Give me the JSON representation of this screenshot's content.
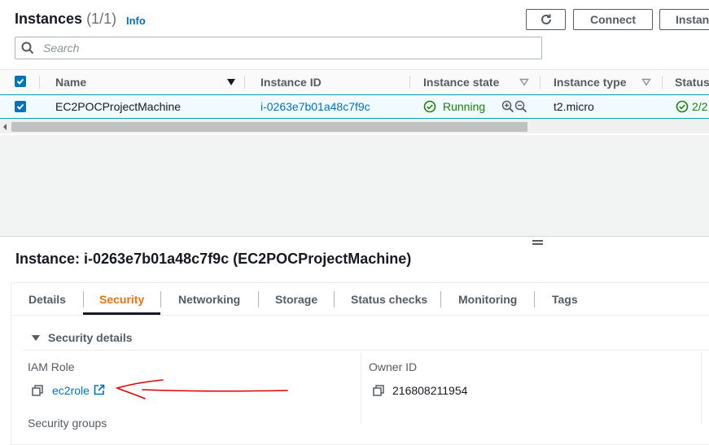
{
  "instances_panel": {
    "title": "Instances",
    "count": "(1/1)",
    "info_link": "Info",
    "buttons": {
      "connect": "Connect",
      "instance_state": "Instan"
    },
    "search": {
      "placeholder": "Search",
      "value": ""
    },
    "columns": [
      "Name",
      "Instance ID",
      "Instance state",
      "Instance type",
      "Status"
    ],
    "rows": [
      {
        "selected": true,
        "name": "EC2POCProjectMachine",
        "instance_id": "i-0263e7b01a48c7f9c",
        "state": "Running",
        "type": "t2.micro",
        "status": "2/2"
      }
    ]
  },
  "details_panel": {
    "title": "Instance: i-0263e7b01a48c7f9c (EC2POCProjectMachine)",
    "tabs": [
      "Details",
      "Security",
      "Networking",
      "Storage",
      "Status checks",
      "Monitoring",
      "Tags"
    ],
    "active_tab": "Security",
    "section": {
      "title": "Security details",
      "iam_role_label": "IAM Role",
      "iam_role_value": "ec2role",
      "owner_id_label": "Owner ID",
      "owner_id_value": "216808211954",
      "security_groups_label": "Security groups"
    }
  },
  "colors": {
    "link": "#0073bb",
    "running": "#1d8102",
    "active_tab": "#ec7211",
    "selection": "#f1faff",
    "annotation": "#e00000"
  },
  "icons": [
    "refresh-icon",
    "search-icon",
    "sort-caret-icon",
    "check-icon",
    "running-status-icon",
    "zoom-in-icon",
    "zoom-out-icon",
    "copy-icon",
    "external-link-icon",
    "collapse-caret-icon"
  ]
}
